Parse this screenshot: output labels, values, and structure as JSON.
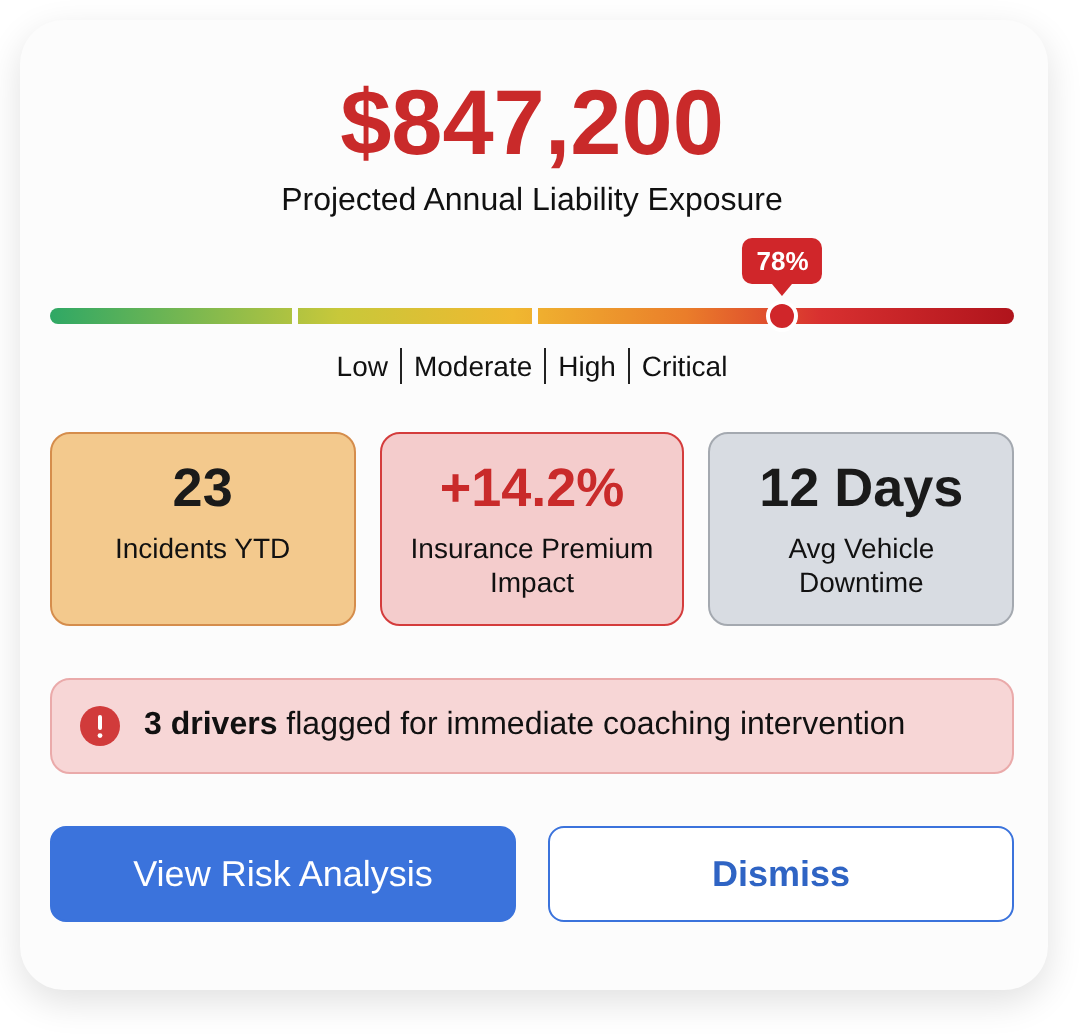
{
  "headline": {
    "amount": "$847,200",
    "caption": "Projected Annual Liability Exposure"
  },
  "gauge": {
    "level": 0.76,
    "badge": "78%",
    "labels": [
      "Low",
      "Moderate",
      "High",
      "Critical"
    ]
  },
  "stats": [
    {
      "kind": "warning",
      "value": "23",
      "label": "Incidents YTD"
    },
    {
      "kind": "danger",
      "value": "+14.2%",
      "label": "Insurance Premium Impact"
    },
    {
      "kind": "neutral",
      "value": "12 Days",
      "label": "Avg Vehicle Downtime"
    }
  ],
  "alert": {
    "text": "**3 drivers** flagged for immediate coaching intervention"
  },
  "buttons": [
    {
      "kind": "primary",
      "label": "View Risk Analysis"
    },
    {
      "kind": "secondary",
      "label": "Dismiss"
    }
  ]
}
